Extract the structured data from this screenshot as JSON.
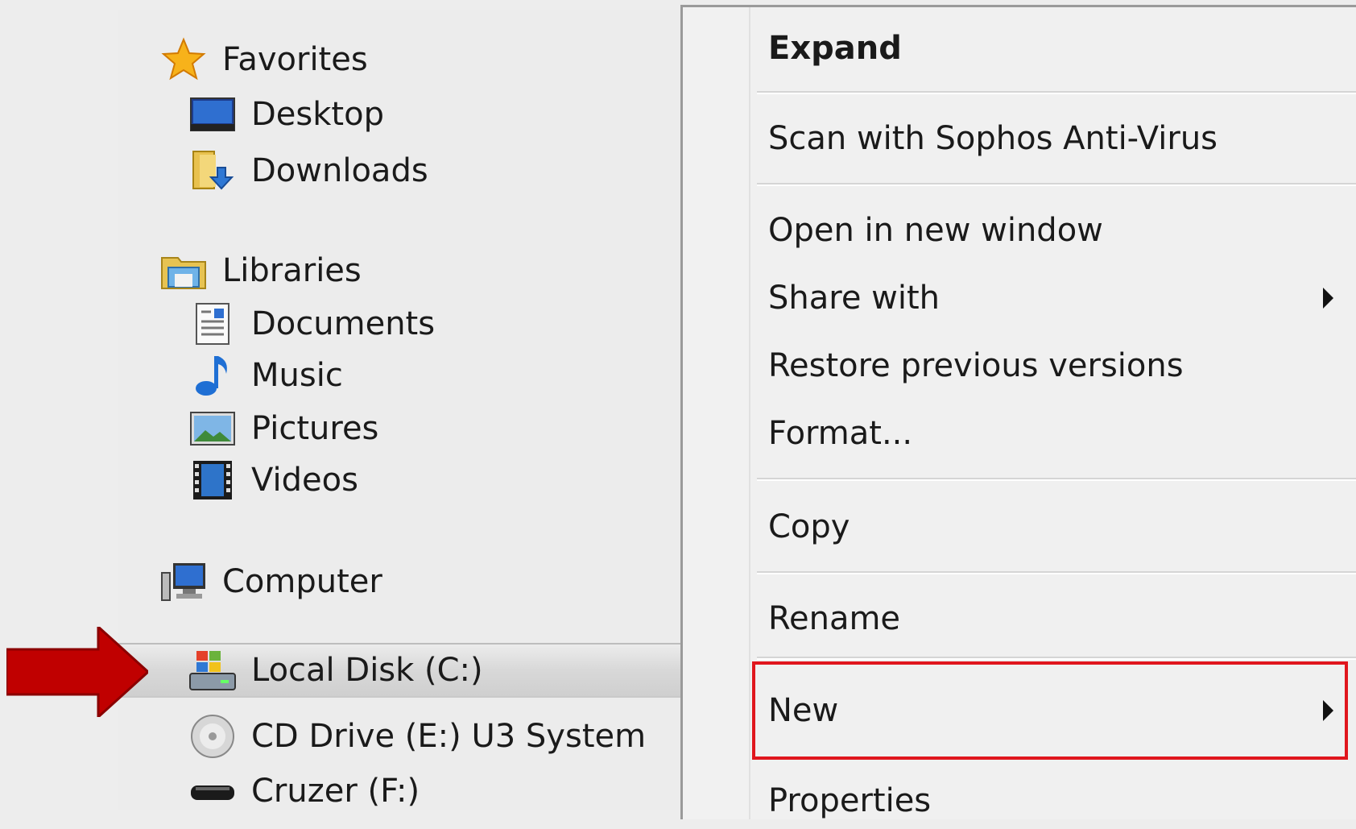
{
  "nav": {
    "favorites": {
      "label": "Favorites",
      "icon": "star-icon"
    },
    "desktop": {
      "label": "Desktop",
      "icon": "desktop-icon"
    },
    "downloads": {
      "label": "Downloads",
      "icon": "downloads-folder-icon"
    },
    "libraries": {
      "label": "Libraries",
      "icon": "libraries-icon"
    },
    "documents": {
      "label": "Documents",
      "icon": "documents-icon"
    },
    "music": {
      "label": "Music",
      "icon": "music-note-icon"
    },
    "pictures": {
      "label": "Pictures",
      "icon": "pictures-icon"
    },
    "videos": {
      "label": "Videos",
      "icon": "film-icon"
    },
    "computer": {
      "label": "Computer",
      "icon": "computer-icon"
    },
    "local_disk": {
      "label": "Local Disk (C:)",
      "icon": "windows-drive-icon"
    },
    "cd_drive": {
      "label": "CD Drive (E:) U3 System",
      "icon": "cd-icon"
    },
    "cruzer": {
      "label": "Cruzer (F:)",
      "icon": "usb-drive-icon"
    }
  },
  "menu": {
    "expand": "Expand",
    "scan": "Scan with Sophos Anti-Virus",
    "open_new_window": "Open in new window",
    "share_with": "Share with",
    "restore": "Restore previous versions",
    "format": "Format...",
    "copy": "Copy",
    "rename": "Rename",
    "new": "New",
    "properties": "Properties"
  },
  "colors": {
    "highlight_border": "#e0161d",
    "arrow": "#c00000"
  }
}
